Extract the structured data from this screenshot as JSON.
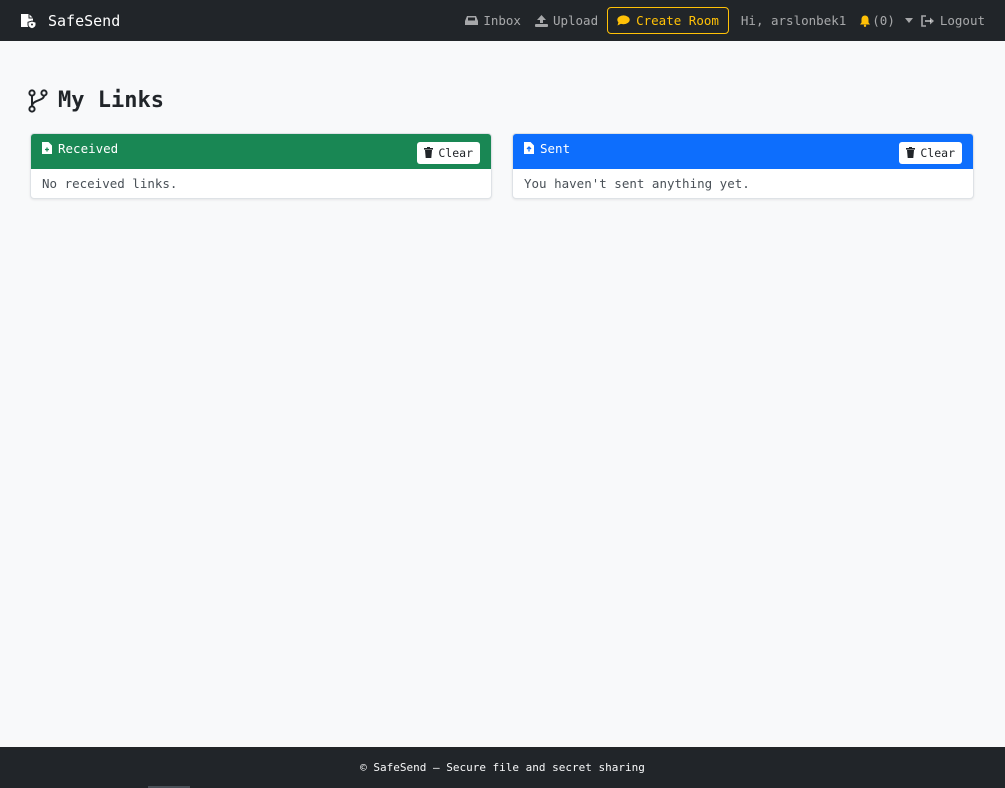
{
  "navbar": {
    "brand": "SafeSend",
    "links": {
      "inbox": "Inbox",
      "upload": "Upload",
      "create_room": "Create Room"
    },
    "greeting": "Hi, arslonbek1",
    "notifications": "(0)",
    "logout": "Logout"
  },
  "page": {
    "title": "My Links"
  },
  "cards": {
    "received": {
      "title": "Received",
      "clear_label": "Clear",
      "empty_text": "No received links.",
      "color": "#198754"
    },
    "sent": {
      "title": "Sent",
      "clear_label": "Clear",
      "empty_text": "You haven't sent anything yet.",
      "color": "#0d6efd"
    }
  },
  "footer": {
    "text": "© SafeSend — Secure file and secret sharing"
  },
  "colors": {
    "navbar_bg": "#212529",
    "accent_warning": "#ffc107",
    "page_bg": "#f8f9fa"
  },
  "icons": {
    "brand": "file-shield-icon",
    "inbox": "inbox-icon",
    "upload": "upload-icon",
    "create_room": "chat-bubble-icon",
    "bell": "bell-icon",
    "caret": "caret-down-icon",
    "logout": "logout-icon",
    "title": "branch-icon",
    "card": "file-icon",
    "clear": "trash-icon"
  }
}
